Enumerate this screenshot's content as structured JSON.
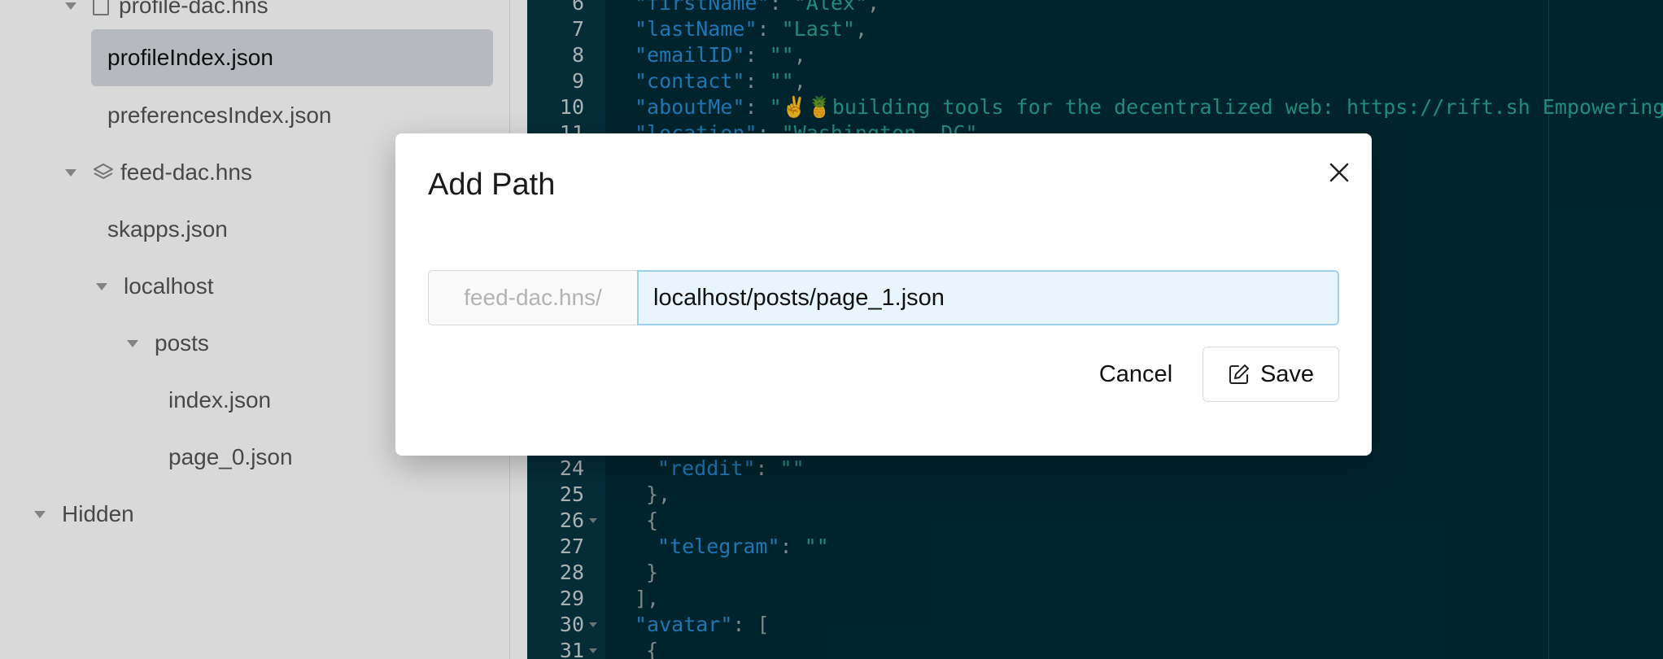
{
  "sidebar": {
    "profile_dac": "profile-dac.hns",
    "profile_index": "profileIndex.json",
    "preferences_index": "preferencesIndex.json",
    "feed_dac": "feed-dac.hns",
    "skapps": "skapps.json",
    "localhost": "localhost",
    "posts": "posts",
    "index": "index.json",
    "page_0": "page_0.json",
    "hidden": "Hidden"
  },
  "editor": {
    "lines": [
      {
        "n": "6",
        "fold": false,
        "indent": 2,
        "key": "\"firstName\"",
        "sep": ": ",
        "val": "\"Alex\"",
        "tail": ","
      },
      {
        "n": "7",
        "fold": false,
        "indent": 2,
        "key": "\"lastName\"",
        "sep": ": ",
        "val": "\"Last\"",
        "tail": ","
      },
      {
        "n": "8",
        "fold": false,
        "indent": 2,
        "key": "\"emailID\"",
        "sep": ": ",
        "val": "\"\"",
        "tail": ","
      },
      {
        "n": "9",
        "fold": false,
        "indent": 2,
        "key": "\"contact\"",
        "sep": ": ",
        "val": "\"\"",
        "tail": ","
      },
      {
        "n": "10",
        "fold": false,
        "indent": 2,
        "key": "\"aboutMe\"",
        "sep": ": ",
        "val": "\"✌️🍍building tools for the decentralized web: https://rift.sh Empowering user",
        "tail": ""
      },
      {
        "n": "11",
        "fold": false,
        "indent": 2,
        "key": "\"location\"",
        "sep": ": ",
        "val": "\"Washington, DC\"",
        "tail": ""
      },
      {
        "n": "24",
        "fold": false,
        "indent": 4,
        "key": "\"reddit\"",
        "sep": ": ",
        "val": "\"\"",
        "tail": ""
      },
      {
        "n": "25",
        "fold": false,
        "indent": 3,
        "key": "",
        "sep": "",
        "val": "",
        "tail": "},"
      },
      {
        "n": "26",
        "fold": true,
        "indent": 3,
        "key": "",
        "sep": "",
        "val": "",
        "tail": "{"
      },
      {
        "n": "27",
        "fold": false,
        "indent": 4,
        "key": "\"telegram\"",
        "sep": ": ",
        "val": "\"\"",
        "tail": ""
      },
      {
        "n": "28",
        "fold": false,
        "indent": 3,
        "key": "",
        "sep": "",
        "val": "",
        "tail": "}"
      },
      {
        "n": "29",
        "fold": false,
        "indent": 2,
        "key": "",
        "sep": "",
        "val": "",
        "tail": "],"
      },
      {
        "n": "30",
        "fold": true,
        "indent": 2,
        "key": "\"avatar\"",
        "sep": ": ",
        "val": "",
        "tail": "["
      },
      {
        "n": "31",
        "fold": true,
        "indent": 3,
        "key": "",
        "sep": "",
        "val": "",
        "tail": "{"
      }
    ]
  },
  "modal": {
    "title": "Add Path",
    "prefix": "feed-dac.hns/",
    "path_value": "localhost/posts/page_1.json",
    "cancel_label": "Cancel",
    "save_label": "Save"
  }
}
